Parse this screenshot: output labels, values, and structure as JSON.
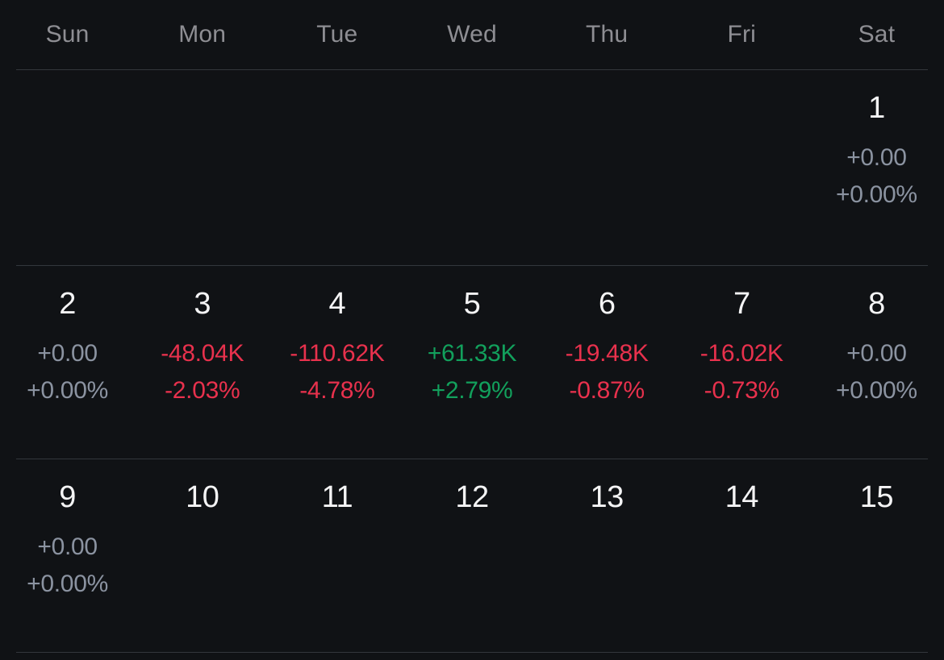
{
  "header": {
    "weekdays": [
      "Sun",
      "Mon",
      "Tue",
      "Wed",
      "Thu",
      "Fri",
      "Sat"
    ]
  },
  "colors": {
    "background": "#101215",
    "divider": "#33373c",
    "weekday_label": "#8e8e93",
    "day_number": "#f4f4f5",
    "positive": "#12a05c",
    "negative": "#e8314d",
    "zero": "#8b93a1"
  },
  "weeks": [
    {
      "days": [
        {
          "day": "",
          "amount": "",
          "percent": "",
          "state": "empty"
        },
        {
          "day": "",
          "amount": "",
          "percent": "",
          "state": "empty"
        },
        {
          "day": "",
          "amount": "",
          "percent": "",
          "state": "empty"
        },
        {
          "day": "",
          "amount": "",
          "percent": "",
          "state": "empty"
        },
        {
          "day": "",
          "amount": "",
          "percent": "",
          "state": "empty"
        },
        {
          "day": "",
          "amount": "",
          "percent": "",
          "state": "empty"
        },
        {
          "day": "1",
          "amount": "+0.00",
          "percent": "+0.00%",
          "state": "zero"
        }
      ]
    },
    {
      "days": [
        {
          "day": "2",
          "amount": "+0.00",
          "percent": "+0.00%",
          "state": "zero"
        },
        {
          "day": "3",
          "amount": "-48.04K",
          "percent": "-2.03%",
          "state": "neg"
        },
        {
          "day": "4",
          "amount": "-110.62K",
          "percent": "-4.78%",
          "state": "neg"
        },
        {
          "day": "5",
          "amount": "+61.33K",
          "percent": "+2.79%",
          "state": "pos"
        },
        {
          "day": "6",
          "amount": "-19.48K",
          "percent": "-0.87%",
          "state": "neg"
        },
        {
          "day": "7",
          "amount": "-16.02K",
          "percent": "-0.73%",
          "state": "neg"
        },
        {
          "day": "8",
          "amount": "+0.00",
          "percent": "+0.00%",
          "state": "zero"
        }
      ]
    },
    {
      "days": [
        {
          "day": "9",
          "amount": "+0.00",
          "percent": "+0.00%",
          "state": "zero"
        },
        {
          "day": "10",
          "amount": "",
          "percent": "",
          "state": "none"
        },
        {
          "day": "11",
          "amount": "",
          "percent": "",
          "state": "none"
        },
        {
          "day": "12",
          "amount": "",
          "percent": "",
          "state": "none"
        },
        {
          "day": "13",
          "amount": "",
          "percent": "",
          "state": "none"
        },
        {
          "day": "14",
          "amount": "",
          "percent": "",
          "state": "none"
        },
        {
          "day": "15",
          "amount": "",
          "percent": "",
          "state": "none"
        }
      ]
    }
  ]
}
